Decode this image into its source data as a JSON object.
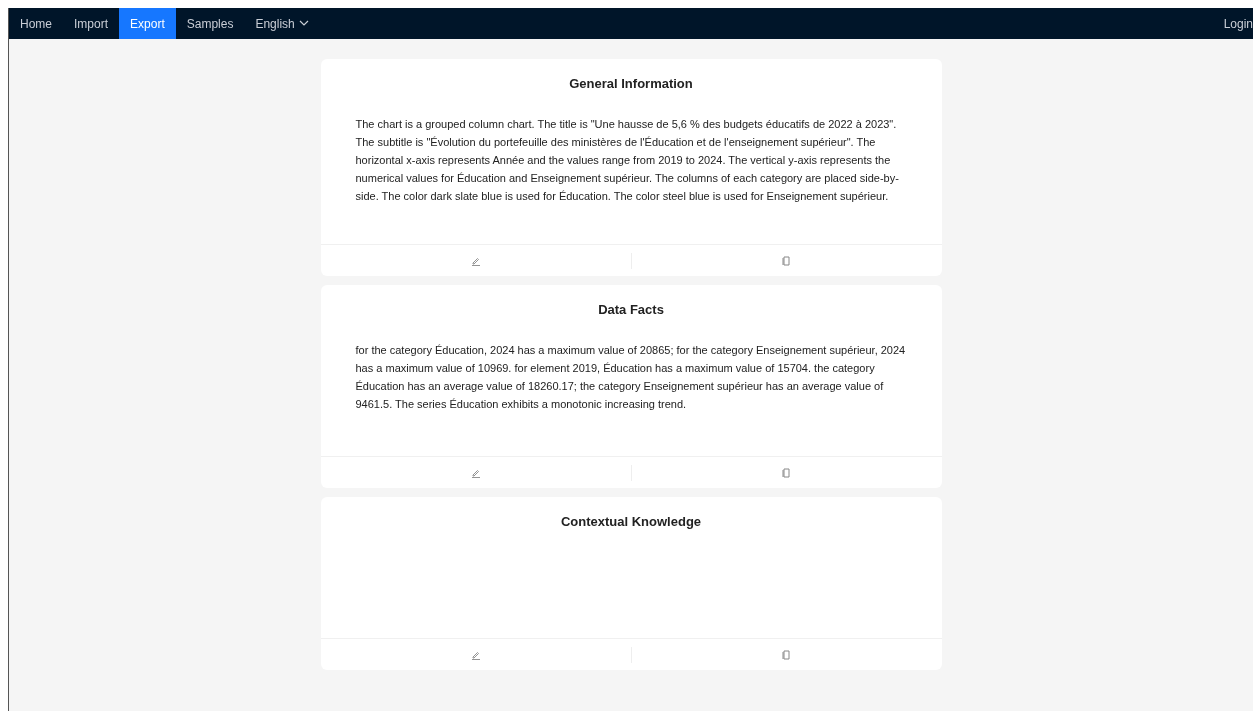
{
  "nav": {
    "items": [
      {
        "label": "Home",
        "selected": false
      },
      {
        "label": "Import",
        "selected": false
      },
      {
        "label": "Export",
        "selected": true
      },
      {
        "label": "Samples",
        "selected": false
      }
    ],
    "language": "English",
    "login": "Login"
  },
  "cards": [
    {
      "title": "General Information",
      "text": "The chart is a grouped column chart. The title is \"Une hausse de 5,6 % des budgets éducatifs de 2022 à 2023\". The subtitle is \"Évolution du portefeuille des ministères de l'Éducation et de l'enseignement supérieur\". The horizontal x-axis represents Année and the values range from 2019 to 2024. The vertical y-axis represents the numerical values for Éducation and Enseignement supérieur. The columns of each category are placed side-by-side. The color dark slate blue is used for Éducation. The color steel blue is used for Enseignement supérieur."
    },
    {
      "title": "Data Facts",
      "text": "for the category Éducation, 2024 has a maximum value of 20865; for the category Enseignement supérieur, 2024 has a maximum value of 10969. for element 2019, Éducation has a maximum value of 15704. the category Éducation has an average value of 18260.17; the category Enseignement supérieur has an average value of 9461.5. The series Éducation exhibits a monotonic increasing trend."
    },
    {
      "title": "Contextual Knowledge"
    }
  ]
}
